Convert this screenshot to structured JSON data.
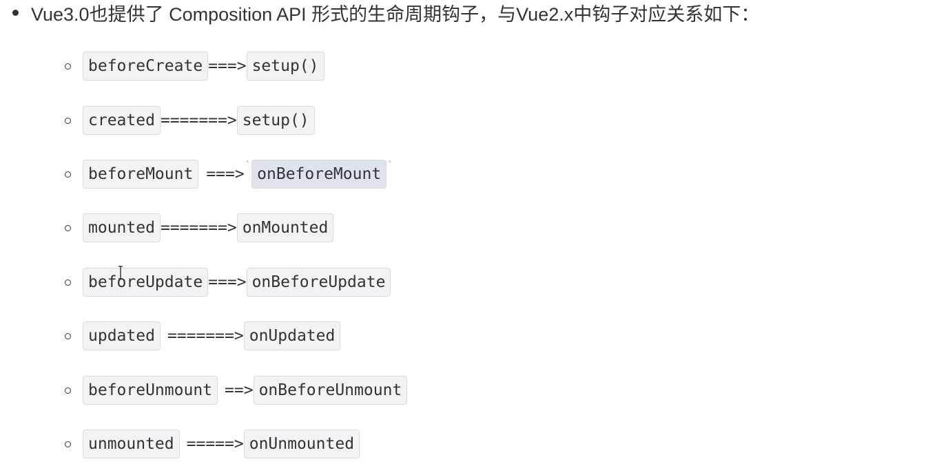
{
  "intro": {
    "text": "Vue3.0也提供了 Composition API 形式的生命周期钩子，与Vue2.x中钩子对应关系如下："
  },
  "hooks": [
    {
      "vue2": "beforeCreate",
      "arrow": "===>",
      "vue3": "setup()"
    },
    {
      "vue2": "created",
      "arrow": "=======>",
      "vue3": "setup()"
    },
    {
      "vue2": "beforeMount",
      "arrow": "===>",
      "vue3": "onBeforeMount"
    },
    {
      "vue2": "mounted",
      "arrow": "=======>",
      "vue3": "onMounted"
    },
    {
      "vue2": "beforeUpdate",
      "arrow": "===>",
      "vue3": "onBeforeUpdate"
    },
    {
      "vue2": "updated",
      "arrow": "=======>",
      "vue3": "onUpdated"
    },
    {
      "vue2": "beforeUnmount",
      "arrow": "==>",
      "vue3": "onBeforeUnmount"
    },
    {
      "vue2": "unmounted",
      "arrow": "=====>",
      "vue3": "onUnmounted"
    }
  ],
  "marks": {
    "backtick": "`"
  }
}
